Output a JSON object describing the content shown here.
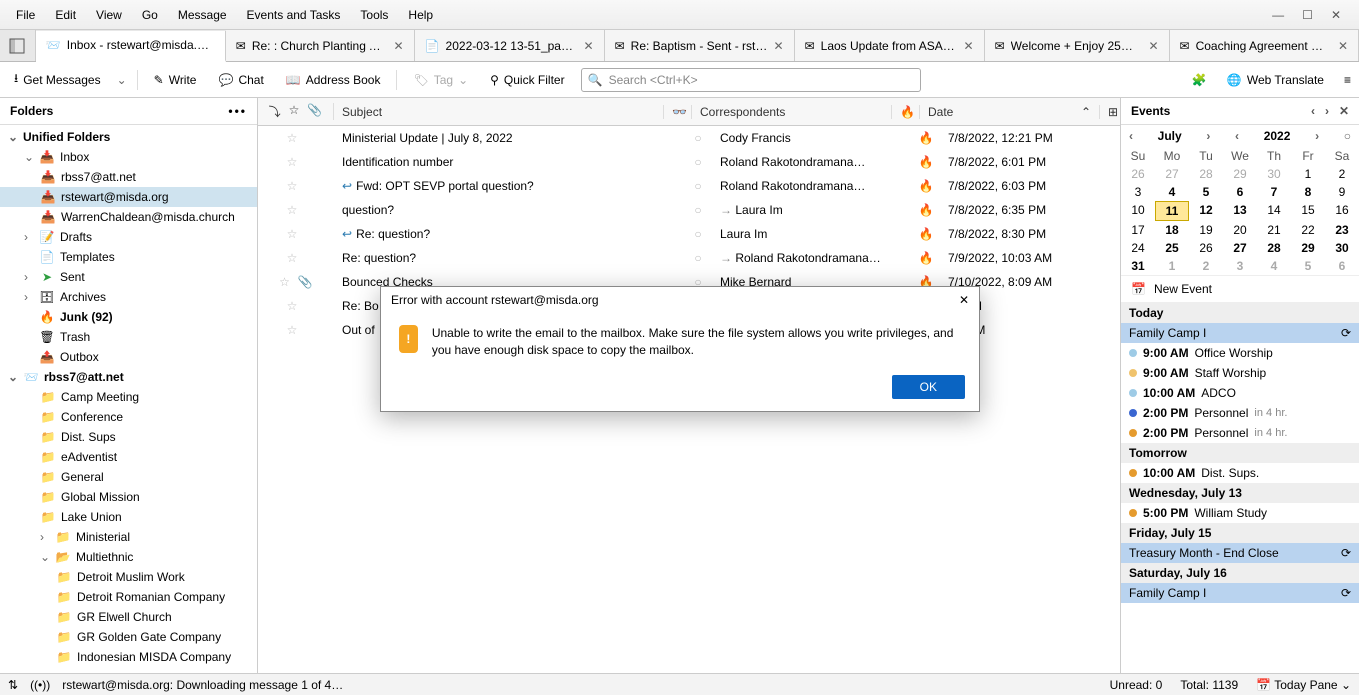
{
  "menu": {
    "items": [
      "File",
      "Edit",
      "View",
      "Go",
      "Message",
      "Events and Tasks",
      "Tools",
      "Help"
    ]
  },
  "tabs": [
    {
      "label": "Inbox - rstewart@misda.or…",
      "active": true
    },
    {
      "label": "Re: : Church Planting A…"
    },
    {
      "label": "2022-03-12 13-51_page…"
    },
    {
      "label": "Re: Baptism - Sent - rste…"
    },
    {
      "label": "Laos Update from ASAP…"
    },
    {
      "label": "Welcome + Enjoy 25%…"
    },
    {
      "label": "Coaching Agreement M…"
    }
  ],
  "toolbar": {
    "get_messages": "Get Messages",
    "write": "Write",
    "chat": "Chat",
    "address_book": "Address Book",
    "tag": "Tag",
    "quick_filter": "Quick Filter",
    "search_placeholder": "Search <Ctrl+K>",
    "web_translate": "Web Translate"
  },
  "folders": {
    "header": "Folders",
    "unified": "Unified Folders",
    "inbox": "Inbox",
    "inbox_children": [
      "rbss7@att.net",
      "rstewart@misda.org",
      "WarrenChaldean@misda.church"
    ],
    "inbox_selected_index": 1,
    "specials": [
      {
        "name": "Drafts",
        "ico": "📝"
      },
      {
        "name": "Templates",
        "ico": "📄"
      },
      {
        "name": "Sent",
        "ico": "📤"
      },
      {
        "name": "Archives",
        "ico": "🗄"
      },
      {
        "name": "Junk (92)",
        "ico": "🔥",
        "bold": true
      },
      {
        "name": "Trash",
        "ico": "🗑"
      },
      {
        "name": "Outbox",
        "ico": "📥"
      }
    ],
    "account2": "rbss7@att.net",
    "account2_folders": [
      "Camp Meeting",
      "Conference",
      "Dist. Sups",
      "eAdventist",
      "General",
      "Global Mission",
      "Lake Union",
      "Ministerial"
    ],
    "multiethnic": "Multiethnic",
    "multiethnic_children": [
      "Detroit Muslim Work",
      "Detroit Romanian Company",
      "GR Elwell Church",
      "GR Golden Gate Company",
      "Indonesian MISDA Company"
    ]
  },
  "messages": {
    "columns": {
      "subject": "Subject",
      "correspondents": "Correspondents",
      "date": "Date"
    },
    "rows": [
      {
        "subject": "Ministerial Update | July 8, 2022",
        "corr": "Cody Francis",
        "date": "7/8/2022, 12:21 PM"
      },
      {
        "subject": "Identification number",
        "corr": "Roland Rakotondramana…",
        "date": "7/8/2022, 6:01 PM"
      },
      {
        "subject": "Fwd: OPT SEVP portal question?",
        "corr": "Roland Rakotondramana…",
        "date": "7/8/2022, 6:03 PM",
        "reply": true
      },
      {
        "subject": "question?",
        "corr": "Laura Im",
        "date": "7/8/2022, 6:35 PM",
        "out": true
      },
      {
        "subject": "Re: question?",
        "corr": "Laura Im",
        "date": "7/8/2022, 8:30 PM",
        "reply": true
      },
      {
        "subject": "Re: question?",
        "corr": "Roland Rakotondramana…",
        "date": "7/9/2022, 10:03 AM",
        "out": true
      },
      {
        "subject": "Bounced Checks",
        "corr": "Mike Bernard",
        "date": "7/10/2022, 8:09 AM",
        "attach": true
      },
      {
        "subject": "Re: Bo",
        "corr": "",
        "date": "34 AM"
      },
      {
        "subject": "Out of",
        "corr": "",
        "date": ":25 AM"
      }
    ]
  },
  "events": {
    "header": "Events",
    "month": "July",
    "year": "2022",
    "dow": [
      "Su",
      "Mo",
      "Tu",
      "We",
      "Th",
      "Fr",
      "Sa"
    ],
    "wk": [
      "26",
      "27",
      "28",
      "29",
      "30",
      "31"
    ],
    "grid": [
      [
        "26",
        "27",
        "28",
        "29",
        "30",
        "1",
        "2"
      ],
      [
        "3",
        "4",
        "5",
        "6",
        "7",
        "8",
        "9"
      ],
      [
        "10",
        "11",
        "12",
        "13",
        "14",
        "15",
        "16"
      ],
      [
        "17",
        "18",
        "19",
        "20",
        "21",
        "22",
        "23"
      ],
      [
        "24",
        "25",
        "26",
        "27",
        "28",
        "29",
        "30"
      ],
      [
        "31",
        "1",
        "2",
        "3",
        "4",
        "5",
        "6"
      ]
    ],
    "bold_days": [
      "27",
      "28",
      "29",
      "30",
      "4",
      "5",
      "6",
      "7",
      "8",
      "11",
      "12",
      "13",
      "18",
      "25",
      "23",
      "1",
      "2",
      "3",
      "4",
      "5",
      "6"
    ],
    "today": "11",
    "new_event": "New Event",
    "sections": [
      {
        "title": "Today",
        "items": [
          {
            "banner": true,
            "label": "Family Camp I"
          },
          {
            "dot": "#9ecbe6",
            "time": "9:00 AM",
            "label": "Office Worship"
          },
          {
            "dot": "#f0c36d",
            "time": "9:00 AM",
            "label": "Staff Worship"
          },
          {
            "dot": "#9ecbe6",
            "time": "10:00 AM",
            "label": "ADCO"
          },
          {
            "dot": "#3a66d1",
            "time": "2:00 PM",
            "label": "Personnel",
            "hint": "in 4 hr."
          },
          {
            "dot": "#e59b2e",
            "time": "2:00 PM",
            "label": "Personnel",
            "hint": "in 4 hr."
          }
        ]
      },
      {
        "title": "Tomorrow",
        "items": [
          {
            "dot": "#e59b2e",
            "time": "10:00 AM",
            "label": "Dist. Sups."
          }
        ]
      },
      {
        "title": "Wednesday, July 13",
        "items": [
          {
            "dot": "#e59b2e",
            "time": "5:00 PM",
            "label": "William Study"
          }
        ]
      },
      {
        "title": "Friday, July 15",
        "items": [
          {
            "banner": true,
            "label": "Treasury Month - End Close"
          }
        ]
      },
      {
        "title": "Saturday, July 16",
        "items": [
          {
            "banner": true,
            "label": "Family Camp I"
          }
        ]
      }
    ]
  },
  "dialog": {
    "title": "Error with account rstewart@misda.org",
    "body": "Unable to write the email to the mailbox. Make sure the file system allows you write privileges, and you have enough disk space to copy the mailbox.",
    "ok": "OK"
  },
  "status": {
    "activity": "rstewart@misda.org: Downloading message 1 of 4…",
    "unread": "Unread: 0",
    "total": "Total: 1139",
    "today_pane": "Today Pane"
  }
}
